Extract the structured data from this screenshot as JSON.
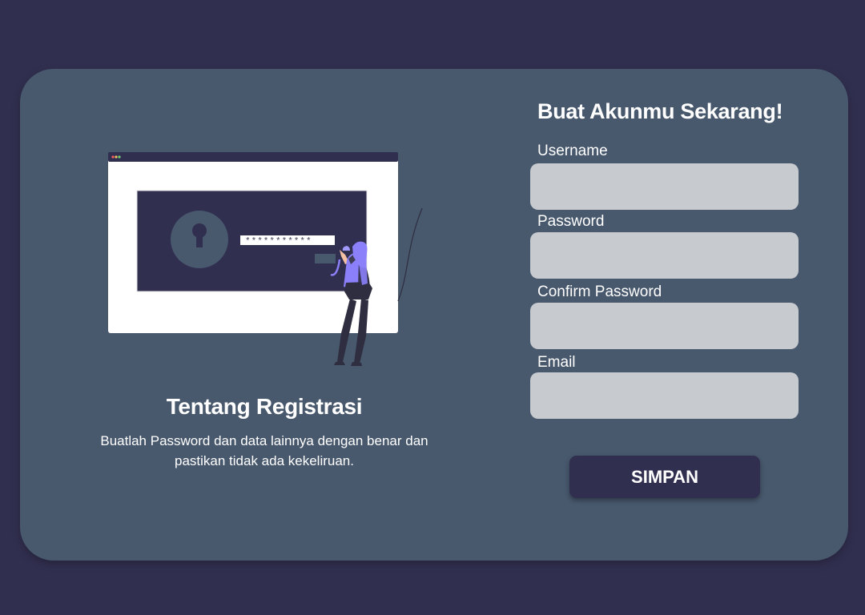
{
  "form": {
    "title": "Buat Akunmu Sekarang!",
    "fields": [
      {
        "label": "Username",
        "value": "",
        "type": "text"
      },
      {
        "label": "Password",
        "value": "",
        "type": "password"
      },
      {
        "label": "Confirm Password",
        "value": "",
        "type": "password"
      },
      {
        "label": "Email",
        "value": "",
        "type": "email"
      }
    ],
    "submit_label": "SIMPAN"
  },
  "about": {
    "title": "Tentang Registrasi",
    "description": "Buatlah Password dan data lainnya dengan benar dan pastikan tidak ada kekeliruan."
  },
  "illustration": {
    "masked_password": "***********"
  },
  "colors": {
    "page_background": "#312f4f",
    "card_background": "#48586d",
    "input_background": "#c7cace",
    "button_background": "#312f4f",
    "accent_purple": "#8b80f9"
  }
}
